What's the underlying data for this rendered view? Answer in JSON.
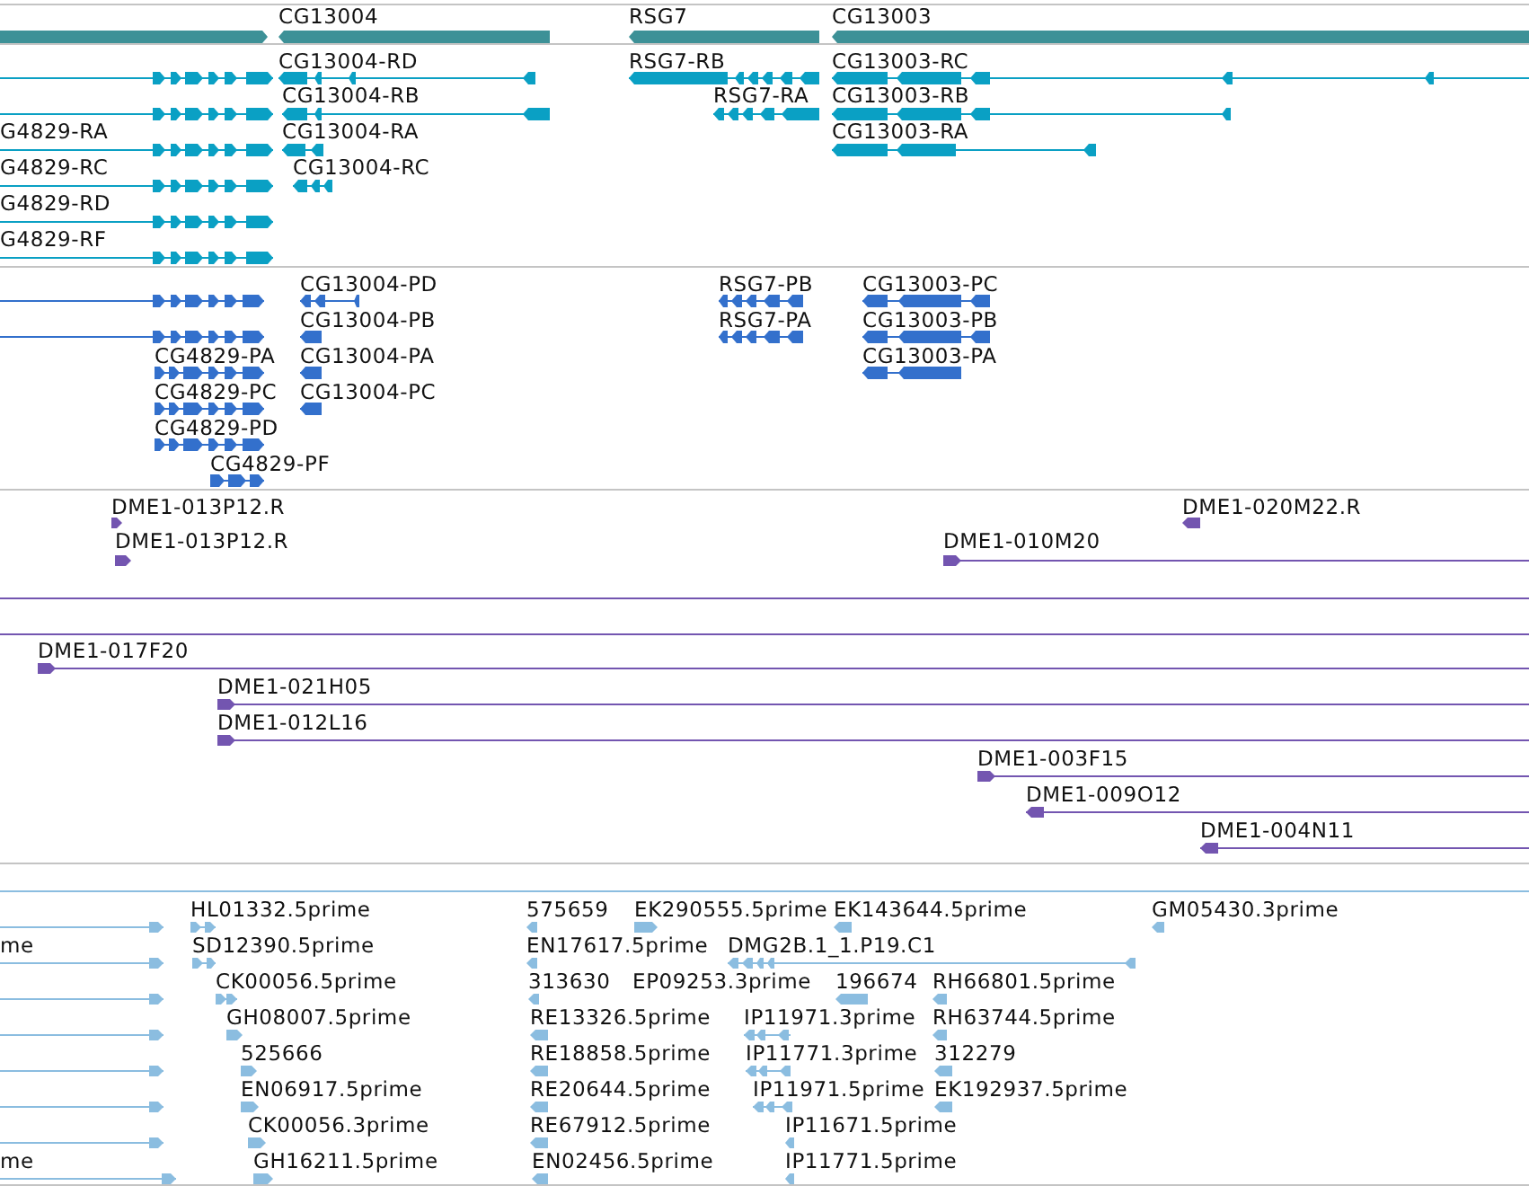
{
  "tracks": [
    {
      "kind": "gene",
      "features": [
        {
          "reverse": false
        },
        {
          "label": "CG13004",
          "reverse": true
        },
        {
          "label": "RSG7",
          "reverse": true
        },
        {
          "label": "CG13003",
          "reverse": true
        }
      ]
    },
    {
      "kind": "transcript",
      "features": [
        {
          "reverse": false
        },
        {
          "label": "CG13004-RD",
          "reverse": true
        },
        {
          "label": "RSG7-RB",
          "reverse": true
        },
        {
          "label": "CG13003-RC",
          "reverse": true
        },
        {
          "reverse": false
        },
        {
          "label": "CG13004-RB",
          "reverse": true
        },
        {
          "label": "RSG7-RA",
          "reverse": true
        },
        {
          "label": "CG13003-RB",
          "reverse": true
        },
        {
          "label": "G4829-RA",
          "reverse": false
        },
        {
          "label": "CG13004-RA",
          "reverse": true
        },
        {
          "label": "CG13003-RA",
          "reverse": true
        },
        {
          "label": "G4829-RC",
          "reverse": false
        },
        {
          "label": "CG13004-RC",
          "reverse": true
        },
        {
          "label": "G4829-RD",
          "reverse": false
        },
        {
          "label": "G4829-RF",
          "reverse": false
        }
      ]
    },
    {
      "kind": "protein",
      "features": [
        {
          "reverse": false
        },
        {
          "label": "CG13004-PD",
          "reverse": true
        },
        {
          "label": "RSG7-PB",
          "reverse": true
        },
        {
          "label": "CG13003-PC",
          "reverse": true
        },
        {
          "reverse": false
        },
        {
          "label": "CG13004-PB",
          "reverse": true
        },
        {
          "label": "RSG7-PA",
          "reverse": true
        },
        {
          "label": "CG13003-PB",
          "reverse": true
        },
        {
          "label": "CG4829-PA",
          "reverse": false
        },
        {
          "label": "CG13004-PA",
          "reverse": true
        },
        {
          "label": "CG13003-PA",
          "reverse": true
        },
        {
          "label": "CG4829-PC",
          "reverse": false
        },
        {
          "label": "CG13004-PC",
          "reverse": true
        },
        {
          "label": "CG4829-PD",
          "reverse": false
        },
        {
          "label": "CG4829-PF",
          "reverse": false
        }
      ]
    },
    {
      "kind": "clone",
      "features": [
        {
          "kind": "feature",
          "label": "DME1-013P12.R",
          "reverse": false
        },
        {
          "kind": "feature",
          "label": "DME1-020M22.R",
          "reverse": true
        },
        {
          "kind": "feature",
          "label": "DME1-013P12.R",
          "reverse": false
        },
        {
          "kind": "feature",
          "label": "DME1-010M20",
          "reverse": false
        },
        {
          "kind": "span"
        },
        {
          "kind": "span"
        },
        {
          "kind": "feature",
          "label": "DME1-017F20",
          "reverse": false
        },
        {
          "kind": "feature",
          "label": "DME1-021H05",
          "reverse": false
        },
        {
          "kind": "feature",
          "label": "DME1-012L16",
          "reverse": false
        },
        {
          "kind": "feature",
          "label": "DME1-003F15",
          "reverse": false
        },
        {
          "kind": "feature",
          "label": "DME1-009O12",
          "reverse": true
        },
        {
          "kind": "feature",
          "label": "DME1-004N11",
          "reverse": true
        }
      ]
    },
    {
      "kind": "est",
      "features": [
        {
          "kind": "span"
        },
        {
          "kind": "feature",
          "reverse": false
        },
        {
          "kind": "feature",
          "label": "HL01332.5prime",
          "reverse": false
        },
        {
          "kind": "feature",
          "label": "575659",
          "reverse": true
        },
        {
          "kind": "feature",
          "label": "EK290555.5prime",
          "reverse": false
        },
        {
          "kind": "feature",
          "label": "EK143644.5prime",
          "reverse": true
        },
        {
          "kind": "feature",
          "label": "GM05430.3prime",
          "reverse": true
        },
        {
          "kind": "feature",
          "label": "me",
          "reverse": false
        },
        {
          "kind": "feature",
          "label": "SD12390.5prime",
          "reverse": false
        },
        {
          "kind": "feature",
          "label": "EN17617.5prime",
          "reverse": true
        },
        {
          "kind": "feature",
          "label": "DMG2B.1_1.P19.C1",
          "reverse": true
        },
        {
          "kind": "feature",
          "reverse": false
        },
        {
          "kind": "feature",
          "label": "CK00056.5prime",
          "reverse": false
        },
        {
          "kind": "feature",
          "label": "313630",
          "reverse": true
        },
        {
          "kind": "unplaced",
          "label": "EP09253.3prime"
        },
        {
          "kind": "feature",
          "label": "196674",
          "reverse": true
        },
        {
          "kind": "feature",
          "label": "RH66801.5prime",
          "reverse": true
        },
        {
          "kind": "feature",
          "reverse": false
        },
        {
          "kind": "feature",
          "label": "GH08007.5prime",
          "reverse": false
        },
        {
          "kind": "feature",
          "label": "RE13326.5prime",
          "reverse": true
        },
        {
          "kind": "feature",
          "label": "IP11971.3prime",
          "reverse": true
        },
        {
          "kind": "feature",
          "label": "RH63744.5prime",
          "reverse": true
        },
        {
          "kind": "feature",
          "reverse": false
        },
        {
          "kind": "feature",
          "label": "525666",
          "reverse": false
        },
        {
          "kind": "feature",
          "label": "RE18858.5prime",
          "reverse": true
        },
        {
          "kind": "feature",
          "label": "IP11771.3prime",
          "reverse": true
        },
        {
          "kind": "feature",
          "label": "312279",
          "reverse": true
        },
        {
          "kind": "feature",
          "reverse": false
        },
        {
          "kind": "feature",
          "label": "EN06917.5prime",
          "reverse": false
        },
        {
          "kind": "feature",
          "label": "RE20644.5prime",
          "reverse": true
        },
        {
          "kind": "feature",
          "label": "IP11971.5prime",
          "reverse": true
        },
        {
          "kind": "feature",
          "label": "EK192937.5prime",
          "reverse": true
        },
        {
          "kind": "feature",
          "reverse": false
        },
        {
          "kind": "feature",
          "label": "CK00056.3prime",
          "reverse": false
        },
        {
          "kind": "feature",
          "label": "RE67912.5prime",
          "reverse": true
        },
        {
          "kind": "feature",
          "label": "IP11671.5prime",
          "reverse": true
        },
        {
          "kind": "feature",
          "label": "me",
          "reverse": false
        },
        {
          "kind": "feature",
          "label": "GH16211.5prime",
          "reverse": false
        },
        {
          "kind": "feature",
          "label": "EN02456.5prime",
          "reverse": true
        },
        {
          "kind": "feature",
          "label": "IP11771.5prime",
          "reverse": true
        }
      ]
    }
  ]
}
